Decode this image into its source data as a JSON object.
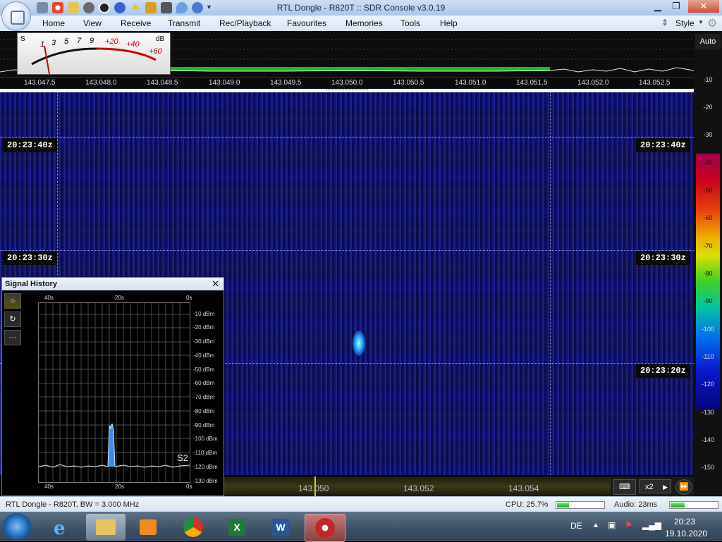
{
  "window": {
    "title": "RTL Dongle - R820T :: SDR Console v3.0.19"
  },
  "menu": {
    "items": [
      "Home",
      "View",
      "Receive",
      "Transmit",
      "Rec/Playback",
      "Favourites",
      "Memories",
      "Tools",
      "Help"
    ],
    "style_label": "Style"
  },
  "meter": {
    "s_label": "S",
    "db_label": "dB",
    "s_scale": [
      "1",
      "3",
      "5",
      "7",
      "9"
    ],
    "plus_scale": [
      "+20",
      "+40",
      "+60"
    ]
  },
  "spectrum": {
    "freq_ticks": [
      "143.047.5",
      "143.048.0",
      "143.048.5",
      "143.049.0",
      "143.049.5",
      "143.050.0",
      "143.050.5",
      "143.051.0",
      "143.051.5",
      "143.052.0",
      "143.052.5"
    ]
  },
  "waterfall": {
    "timestamps": [
      "20:23:40z",
      "20:23:30z",
      "20:23:20z"
    ]
  },
  "right_scale": {
    "auto_label": "Auto",
    "db_ticks": [
      "-10",
      "-20",
      "-30",
      "-40",
      "-50",
      "-60",
      "-70",
      "-80",
      "-90",
      "-100",
      "-110",
      "-120",
      "-130",
      "-140",
      "-150"
    ]
  },
  "bottom_freq": {
    "ticks": [
      "143.050",
      "143.052",
      "143.054"
    ],
    "zoom_label": "x2"
  },
  "signal_history": {
    "title": "Signal History",
    "time_labels": [
      "40s",
      "20s",
      "0s"
    ],
    "dbm_ticks": [
      "-10 dBm",
      "-20 dBm",
      "-30 dBm",
      "-40 dBm",
      "-50 dBm",
      "-60 dBm",
      "-70 dBm",
      "-80 dBm",
      "-90 dBm",
      "-100 dBm",
      "-110 dBm",
      "-120 dBm",
      "-130 dBm"
    ],
    "s_reading": "S2"
  },
  "status": {
    "device": "RTL Dongle - R820T, BW = 3.000 MHz",
    "cpu": "CPU: 25.7%",
    "cpu_fraction": 0.257,
    "audio": "Audio: 23ms",
    "audio_fraction": 0.3
  },
  "taskbar": {
    "language": "DE",
    "time": "20:23",
    "date": "19.10.2020"
  }
}
